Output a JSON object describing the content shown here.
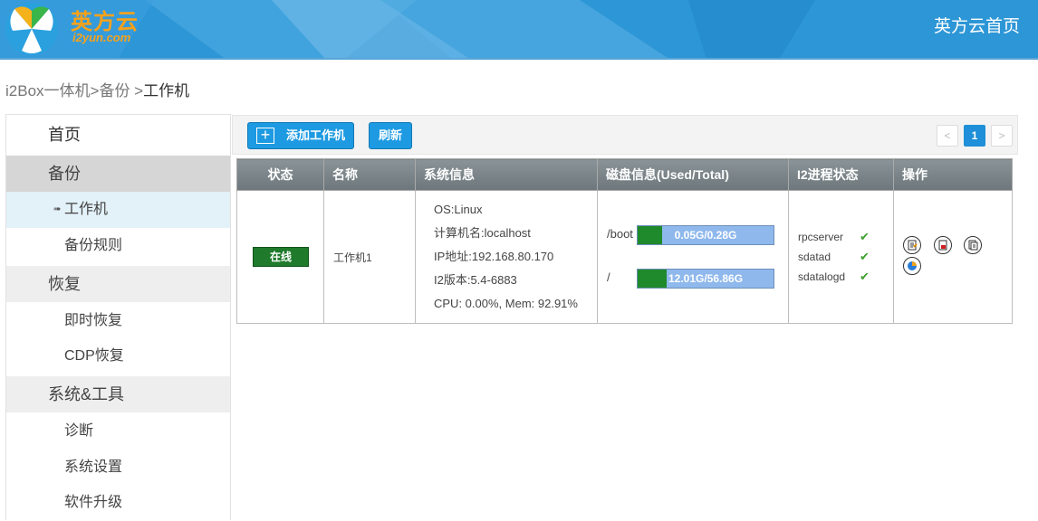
{
  "header": {
    "logo_text": "英方云",
    "logo_sub": "i2yun.com",
    "home_link": "英方云首页",
    "colors": {
      "bar": "#2d96d6",
      "logo": "#f7a21b"
    }
  },
  "breadcrumb": {
    "part1": "i2Box一体机>备份",
    "sep": " >",
    "current": "工作机"
  },
  "sidebar": {
    "home": "首页",
    "backup": "备份",
    "workstation": "工作机",
    "backup_rules": "备份规则",
    "restore": "恢复",
    "instant_restore": "即时恢复",
    "cdp_restore": "CDP恢复",
    "system_tools": "系统&工具",
    "diagnose": "诊断",
    "system_settings": "系统设置",
    "software_upgrade": "软件升级"
  },
  "toolbar": {
    "add_label": "添加工作机",
    "refresh_label": "刷新",
    "pager_prev": "<",
    "pager_current": "1",
    "pager_next": ">"
  },
  "table": {
    "headers": [
      "状态",
      "名称",
      "系统信息",
      "磁盘信息(Used/Total)",
      "I2进程状态",
      "操作"
    ],
    "row": {
      "status": "在线",
      "name": "工作机1",
      "sys_os": "OS:Linux",
      "sys_host": "计算机名:localhost",
      "sys_ip": "IP地址:192.168.80.170",
      "sys_version": "I2版本:5.4-6883",
      "sys_usage": "CPU: 0.00%, Mem: 92.91%",
      "disks": [
        {
          "mount": "/boot",
          "usage": "0.05G/0.28G",
          "fraction": 0.18
        },
        {
          "mount": "/",
          "usage": "12.01G/56.86G",
          "fraction": 0.21
        }
      ],
      "processes": [
        "rpcserver",
        "sdatad",
        "sdatalogd"
      ],
      "process_ok": "✔",
      "operations": [
        "edit-icon",
        "pdf-icon",
        "copy-icon",
        "pie-chart-icon"
      ]
    }
  }
}
